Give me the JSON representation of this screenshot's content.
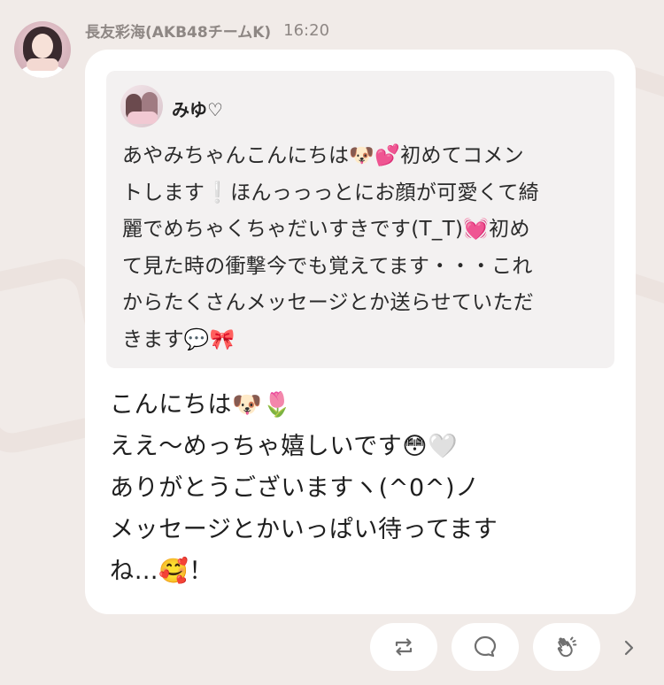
{
  "post": {
    "author": "長友彩海(AKB48チームK)",
    "time": "16:20"
  },
  "quoted": {
    "author": "みゆ♡",
    "lines": [
      "あやみちゃんこんにちは🐶💕初めてコメン",
      "トします❕ほんっっっとにお顔が可愛くて綺",
      "麗でめちゃくちゃだいすきです(T_T)💓初め",
      "て見た時の衝撃今でも覚えてます・・・これ",
      "からたくさんメッセージとか送らせていただ",
      "きます💬🎀"
    ]
  },
  "reply": {
    "lines": [
      "こんにちは🐶🌷",
      "ええ〜めっちゃ嬉しいです😳🤍",
      "ありがとうございますヽ(^0^)ノ",
      "メッセージとかいっぱい待ってます",
      "ね…🥰！"
    ]
  },
  "actions": {
    "icons": [
      "repost-icon",
      "comment-icon",
      "clap-icon",
      "chevron-right-icon"
    ]
  },
  "colors": {
    "background": "#f1ebe8",
    "bubble": "#ffffff",
    "quote_background": "#f3f1f1",
    "header_text": "#8e8784"
  }
}
